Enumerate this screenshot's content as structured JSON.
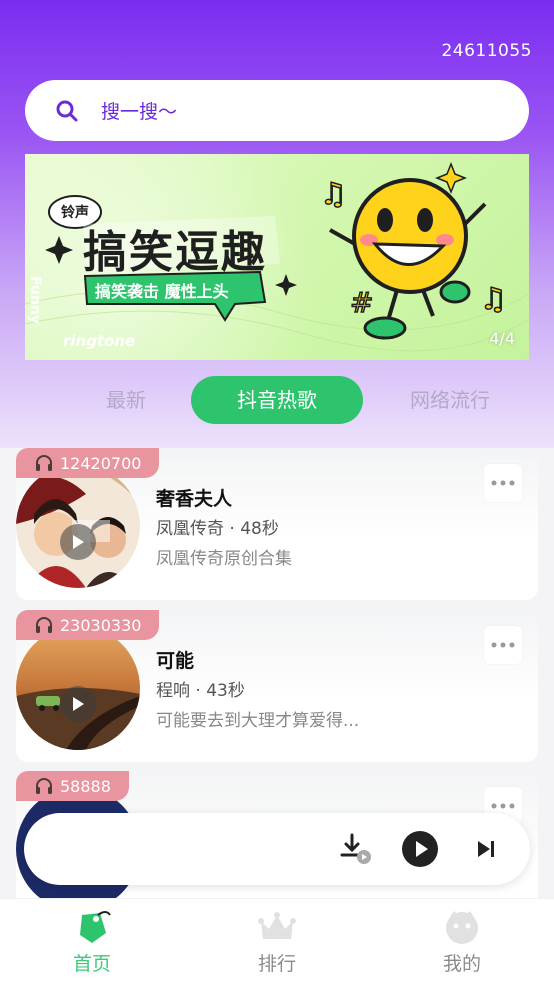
{
  "header": {
    "user_id": "24611055"
  },
  "search": {
    "placeholder": "搜一搜～"
  },
  "banner": {
    "badge": "铃声",
    "title": "搞笑逗趣",
    "subtitle": "搞笑袭击  魔性上头",
    "side_text": "Funny",
    "bottom_text": "ringtone",
    "counter": "4/4"
  },
  "tabs": [
    {
      "label": "最新",
      "active": false
    },
    {
      "label": "抖音热歌",
      "active": true
    },
    {
      "label": "网络流行",
      "active": false
    }
  ],
  "songs": [
    {
      "plays": "12420700",
      "title": "奢香夫人",
      "artist": "凤凰传奇",
      "duration": "48秒",
      "desc": "凤凰传奇原创合集"
    },
    {
      "plays": "23030330",
      "title": "可能",
      "artist": "程响",
      "duration": "43秒",
      "desc": "可能要去到大理才算爱得..."
    },
    {
      "plays": "58888",
      "title": "",
      "artist": "",
      "duration": "",
      "desc": ""
    }
  ],
  "player": {
    "icons": [
      "download-icon",
      "play-icon",
      "next-icon"
    ]
  },
  "bottom_nav": [
    {
      "label": "首页",
      "icon": "tag-icon",
      "active": true
    },
    {
      "label": "排行",
      "icon": "crown-icon",
      "active": false
    },
    {
      "label": "我的",
      "icon": "face-icon",
      "active": false
    }
  ],
  "colors": {
    "accent": "#2ec46e",
    "purple": "#7b2cf0",
    "plays_badge": "#e9959f"
  }
}
